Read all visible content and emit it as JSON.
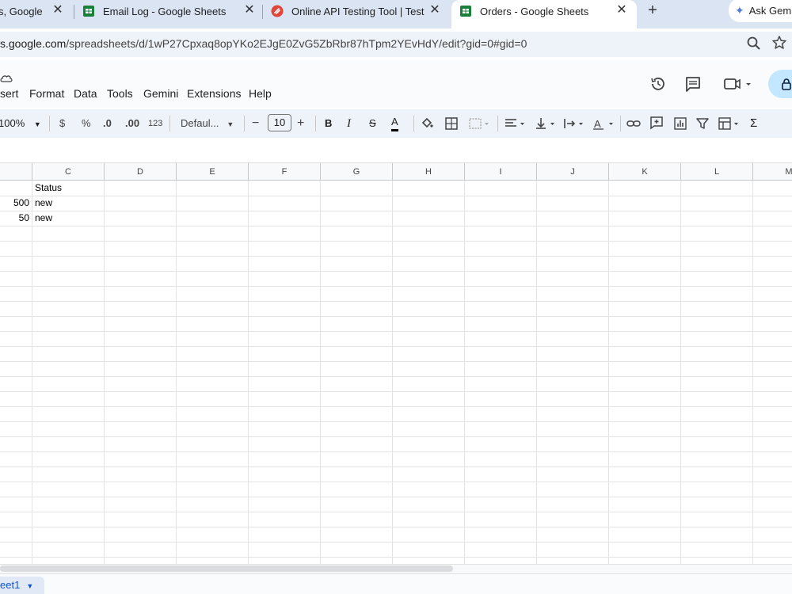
{
  "browser": {
    "tabs": [
      {
        "title": "s, Google",
        "favicon": "google-docs-icon"
      },
      {
        "title": "Email Log - Google Sheets",
        "favicon": "google-sheets-icon"
      },
      {
        "title": "Online API Testing Tool | Test Yo",
        "favicon": "reqbin-icon"
      },
      {
        "title": "Orders - Google Sheets",
        "favicon": "google-sheets-icon",
        "active": true
      }
    ],
    "new_tab_label": "+",
    "ask_gemini_label": "Ask Gem",
    "url_host": "s.google.com",
    "url_path": "/spreadsheets/d/1wP27Cpxaq8opYKo2EJgE0ZvG5ZbRbr87hTpm2YEvHdY/edit?gid=0#gid=0"
  },
  "sheets": {
    "menu": [
      "sert",
      "Format",
      "Data",
      "Tools",
      "Gemini",
      "Extensions",
      "Help"
    ],
    "toolbar": {
      "zoom": "100%",
      "currency": "$",
      "percent": "%",
      "decrease_decimal": ".0",
      "increase_decimal": ".00",
      "number_format": "123",
      "font": "Defaul...",
      "font_size": "10",
      "minus": "−",
      "plus": "+"
    },
    "columns": [
      "C",
      "D",
      "E",
      "F",
      "G",
      "H",
      "I",
      "J",
      "K",
      "L",
      "M"
    ],
    "rows": [
      {
        "b": "",
        "c": "Status"
      },
      {
        "b": "500",
        "c": "new"
      },
      {
        "b": "50",
        "c": "new"
      }
    ],
    "sheet_tab": "eet1"
  },
  "colors": {
    "tabstrip": "#dbe4f3",
    "sheets_green": "#188038",
    "share_blue": "#c2e7ff",
    "sheet_tab_text": "#0b57d0"
  }
}
